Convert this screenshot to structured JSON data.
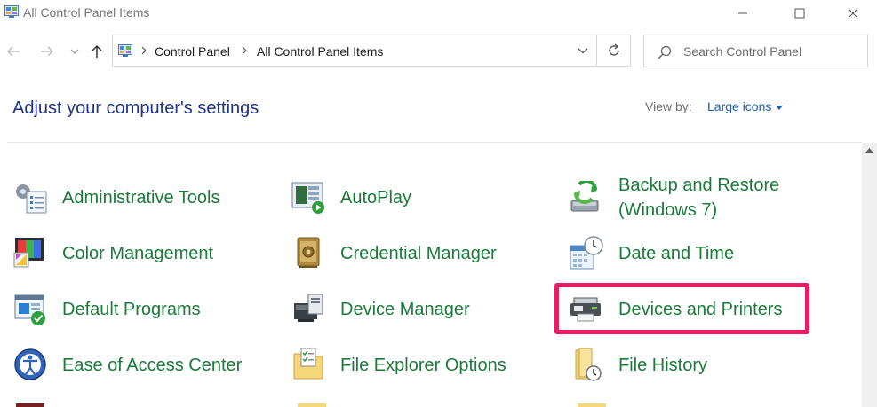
{
  "window": {
    "title": "All Control Panel Items"
  },
  "address": {
    "crumbs": [
      "Control Panel",
      "All Control Panel Items"
    ]
  },
  "search": {
    "placeholder": "Search Control Panel"
  },
  "header": {
    "title": "Adjust your computer's settings",
    "view_by_label": "View by:",
    "view_by_value": "Large icons"
  },
  "items": [
    {
      "label": "Administrative Tools",
      "icon": "administrative-tools-icon"
    },
    {
      "label": "AutoPlay",
      "icon": "autoplay-icon"
    },
    {
      "label": "Backup and Restore (Windows 7)",
      "icon": "backup-restore-icon"
    },
    {
      "label": "Color Management",
      "icon": "color-management-icon"
    },
    {
      "label": "Credential Manager",
      "icon": "credential-manager-icon"
    },
    {
      "label": "Date and Time",
      "icon": "date-time-icon"
    },
    {
      "label": "Default Programs",
      "icon": "default-programs-icon"
    },
    {
      "label": "Device Manager",
      "icon": "device-manager-icon"
    },
    {
      "label": "Devices and Printers",
      "icon": "devices-printers-icon",
      "highlighted": true
    },
    {
      "label": "Ease of Access Center",
      "icon": "ease-of-access-icon"
    },
    {
      "label": "File Explorer Options",
      "icon": "file-explorer-options-icon"
    },
    {
      "label": "File History",
      "icon": "file-history-icon"
    }
  ],
  "colors": {
    "item_text": "#1a7b3a",
    "title_text": "#1e3287",
    "link_text": "#1b5fb3",
    "highlight_border": "#ea1c64"
  }
}
